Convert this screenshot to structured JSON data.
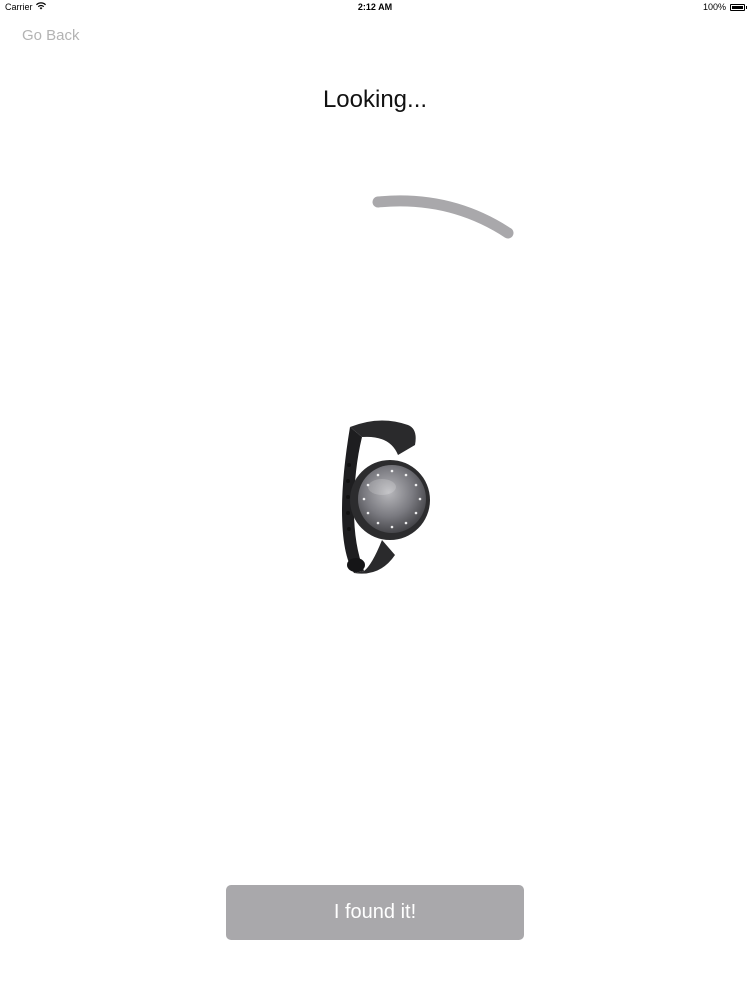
{
  "status_bar": {
    "carrier": "Carrier",
    "wifi_icon": "wifi-icon",
    "time": "2:12 AM",
    "battery_percent": "100%",
    "battery_level": 1.0
  },
  "nav": {
    "back_label": "Go Back"
  },
  "main": {
    "title": "Looking...",
    "spinner_icon": "loading-arc-icon",
    "device_image": "fitness-tracker-band"
  },
  "actions": {
    "found_label": "I found it!",
    "found_button_color": "#a9a8ab"
  }
}
